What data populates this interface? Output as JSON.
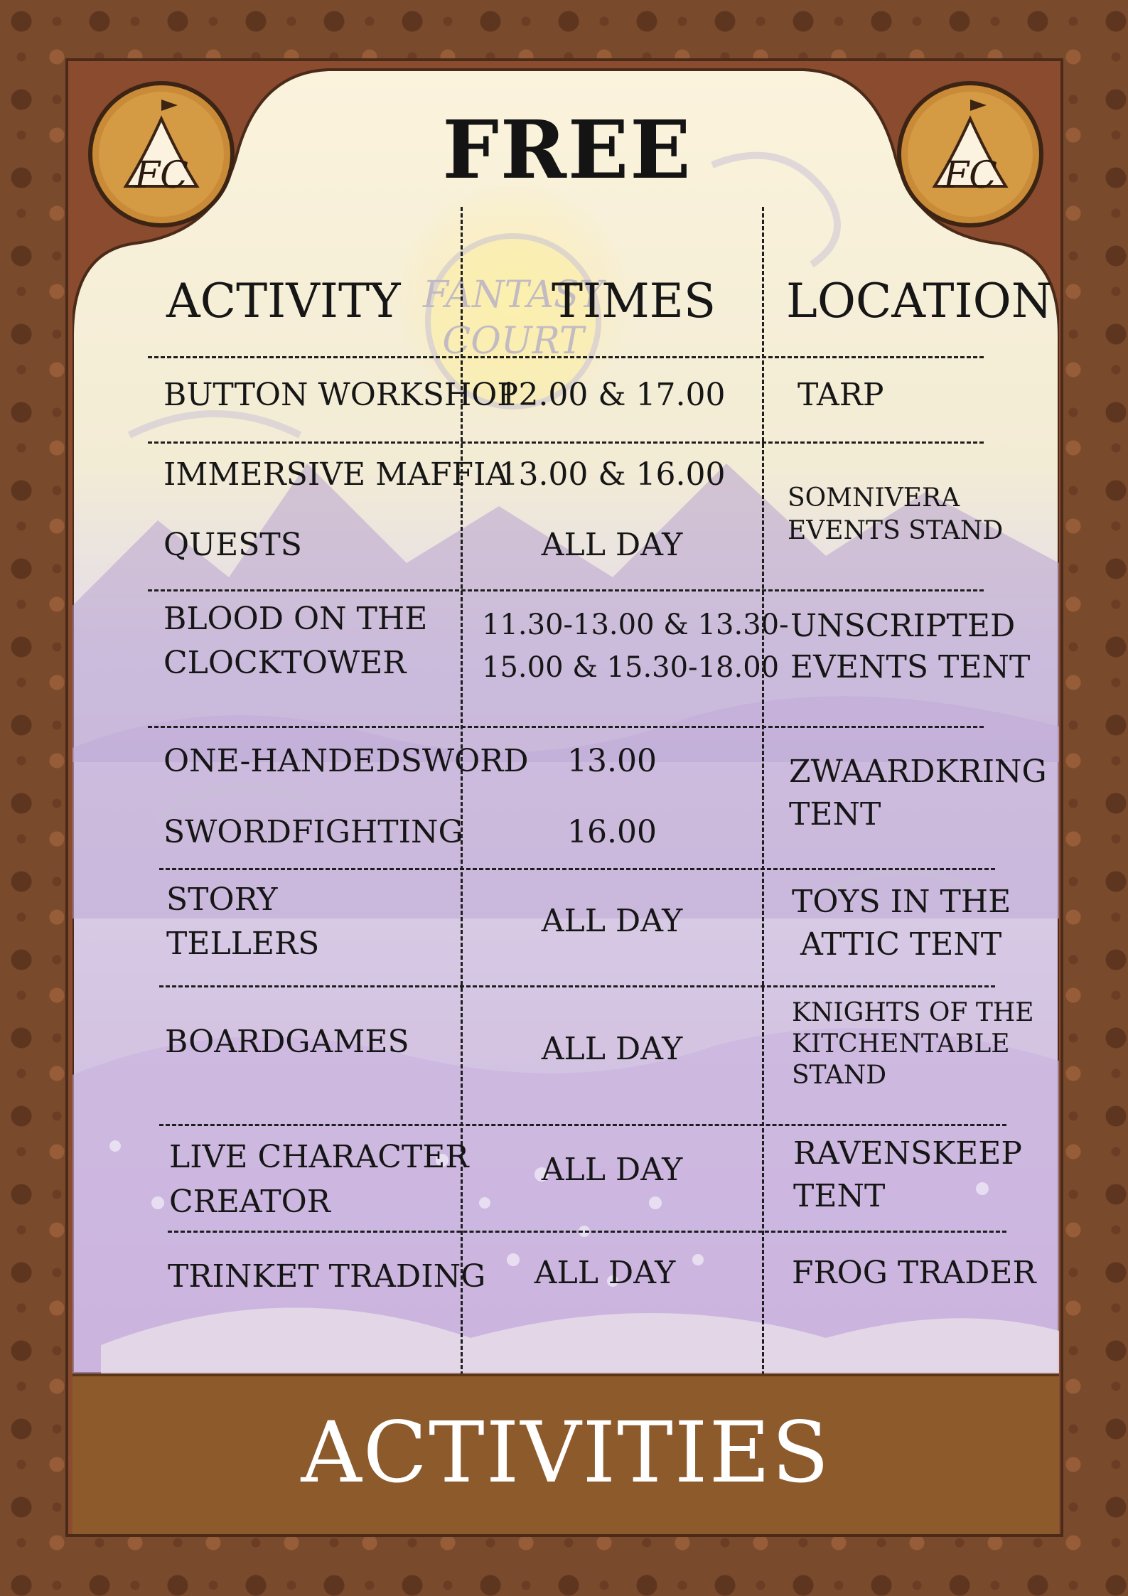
{
  "heading": "FREE",
  "footer_title": "ACTIVITIES",
  "watermark": {
    "line1": "FANTASY",
    "line2": "COURT"
  },
  "emblem": {
    "initials": "FC"
  },
  "columns": [
    "ACTIVITY",
    "TIMES",
    "LOCATION"
  ],
  "rows": [
    {
      "activity": [
        "BUTTON WORKSHOP"
      ],
      "times": [
        "12.00 & 17.00"
      ],
      "location": [
        "TARP"
      ]
    },
    {
      "activity": [
        "IMMERSIVE MAFFIA",
        "QUESTS"
      ],
      "times": [
        "13.00 & 16.00",
        "ALL DAY"
      ],
      "location": [
        "SOMNIVERA",
        "EVENTS STAND"
      ]
    },
    {
      "activity": [
        "BLOOD ON THE",
        "CLOCKTOWER"
      ],
      "times": [
        "11.30-13.00 & 13.30-",
        "15.00 & 15.30-18.00"
      ],
      "location": [
        "UNSCRIPTED",
        "EVENTS TENT"
      ]
    },
    {
      "activity": [
        "ONE-HANDEDSWORD",
        "SWORDFIGHTING"
      ],
      "times": [
        "13.00",
        "16.00"
      ],
      "location": [
        "ZWAARDKRING",
        "TENT"
      ]
    },
    {
      "activity": [
        "STORY",
        "TELLERS"
      ],
      "times": [
        "ALL DAY"
      ],
      "location": [
        "TOYS IN THE",
        "ATTIC TENT"
      ]
    },
    {
      "activity": [
        "BOARDGAMES"
      ],
      "times": [
        "ALL DAY"
      ],
      "location": [
        "KNIGHTS OF THE",
        "KITCHENTABLE",
        "STAND"
      ]
    },
    {
      "activity": [
        "LIVE CHARACTER",
        "CREATOR"
      ],
      "times": [
        "ALL DAY"
      ],
      "location": [
        "RAVENSKEEP",
        "TENT"
      ]
    },
    {
      "activity": [
        "TRINKET TRADING"
      ],
      "times": [
        "ALL DAY"
      ],
      "location": [
        "FROG TRADER"
      ]
    }
  ]
}
